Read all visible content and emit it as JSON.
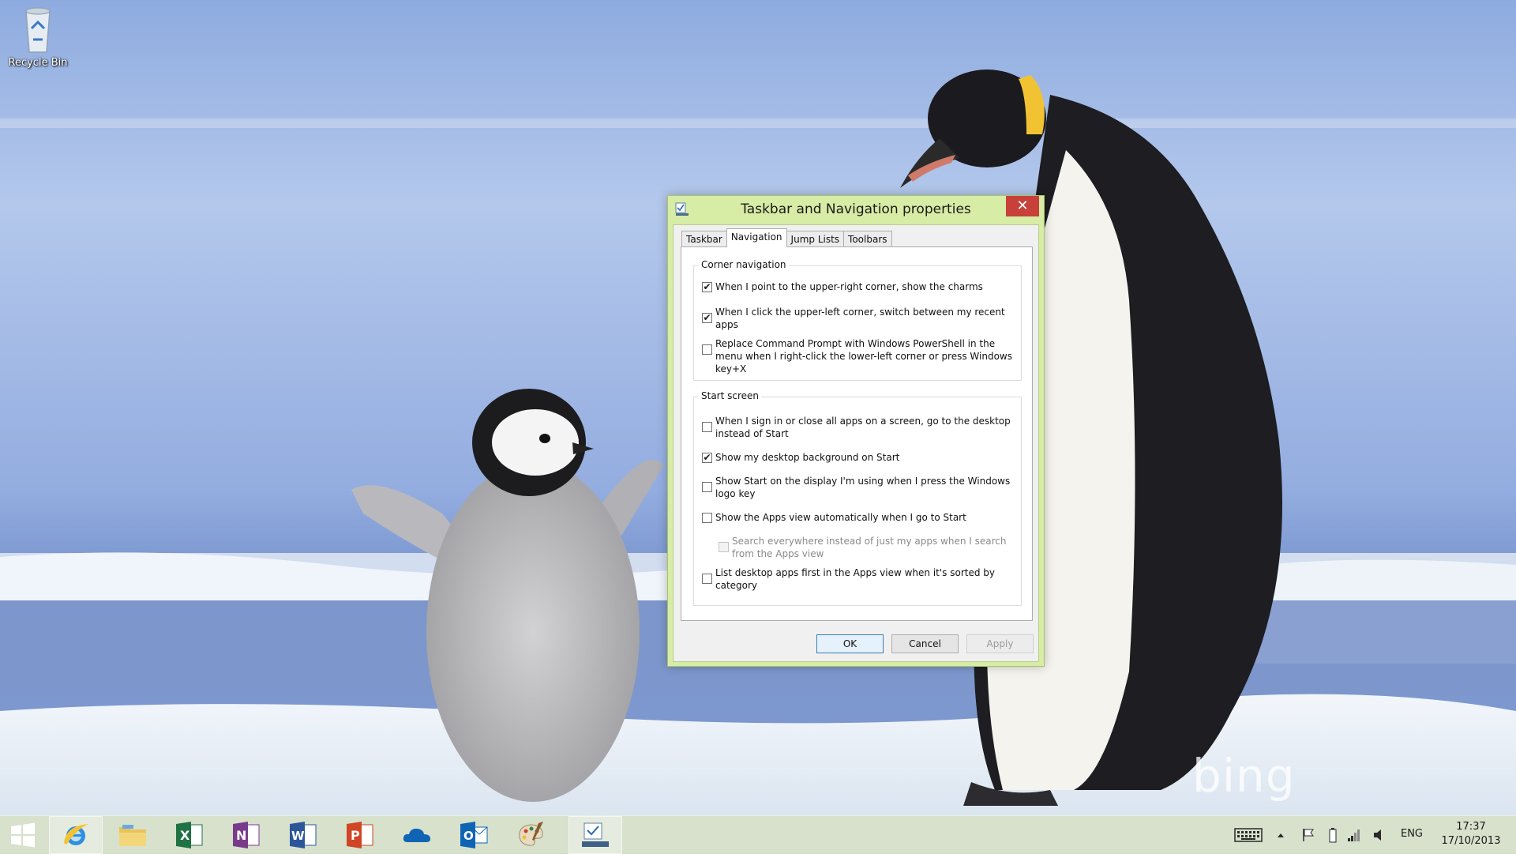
{
  "desktop": {
    "icons": [
      {
        "label": "Recycle Bin",
        "icon": "recycle-bin-icon"
      }
    ],
    "wallpaper_watermark": "bing"
  },
  "dialog": {
    "title": "Taskbar and Navigation properties",
    "close_label": "✕",
    "tabs": [
      {
        "label": "Taskbar",
        "active": false
      },
      {
        "label": "Navigation",
        "active": true
      },
      {
        "label": "Jump Lists",
        "active": false
      },
      {
        "label": "Toolbars",
        "active": false
      }
    ],
    "corner_navigation": {
      "legend": "Corner navigation",
      "options": [
        {
          "text": "When I point to the upper-right corner, show the charms",
          "checked": true
        },
        {
          "text": "When I click the upper-left corner, switch between my recent apps",
          "checked": true
        },
        {
          "text": "Replace Command Prompt with Windows PowerShell in the menu when I right-click the lower-left corner or press Windows key+X",
          "checked": false
        }
      ]
    },
    "start_screen": {
      "legend": "Start screen",
      "options": [
        {
          "text": "When I sign in or close all apps on a screen, go to the desktop instead of Start",
          "checked": false
        },
        {
          "text": "Show my desktop background on Start",
          "checked": true
        },
        {
          "text": "Show Start on the display I'm using when I press the Windows logo key",
          "checked": false
        },
        {
          "text": "Show the Apps view automatically when I go to Start",
          "checked": false
        },
        {
          "text": "Search everywhere instead of just my apps when I search from the Apps view",
          "checked": false,
          "disabled": true
        },
        {
          "text": "List desktop apps first in the Apps view when it's sorted by category",
          "checked": false
        }
      ]
    },
    "buttons": {
      "ok": "OK",
      "cancel": "Cancel",
      "apply": "Apply"
    }
  },
  "taskbar": {
    "apps": [
      {
        "name": "start-button",
        "icon": "windows-logo-icon"
      },
      {
        "name": "internet-explorer",
        "icon": "internet-explorer-icon"
      },
      {
        "name": "file-explorer",
        "icon": "folder-icon"
      },
      {
        "name": "excel",
        "icon": "excel-icon",
        "letter": "X"
      },
      {
        "name": "onenote",
        "icon": "onenote-icon",
        "letter": "N"
      },
      {
        "name": "word",
        "icon": "word-icon",
        "letter": "W"
      },
      {
        "name": "powerpoint",
        "icon": "powerpoint-icon",
        "letter": "P"
      },
      {
        "name": "onedrive",
        "icon": "cloud-icon"
      },
      {
        "name": "outlook",
        "icon": "outlook-icon",
        "letter": "O"
      },
      {
        "name": "paint",
        "icon": "paint-palette-icon"
      },
      {
        "name": "taskbar-properties",
        "icon": "taskbar-properties-icon",
        "active": true
      }
    ],
    "tray": {
      "language": "ENG",
      "time": "17:37",
      "date": "17/10/2013"
    },
    "colors": {
      "excel": "#1f7244",
      "onenote": "#7a3a8c",
      "word": "#2b579a",
      "powerpoint": "#d04525",
      "outlook": "#0f64b4",
      "close_button": "#c7403a"
    }
  }
}
